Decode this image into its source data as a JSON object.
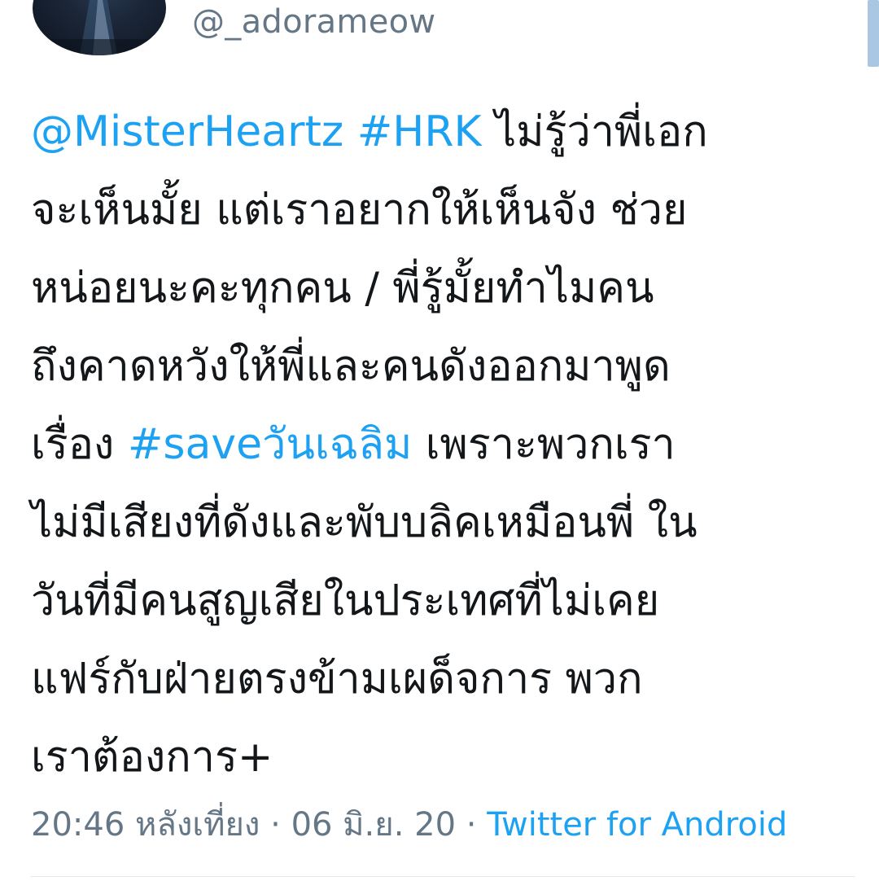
{
  "user": {
    "handle": "@_adorameow"
  },
  "tweet": {
    "lines": [
      [
        {
          "text": "@MisterHeartz",
          "kind": "mention"
        },
        {
          "text": " ",
          "kind": "text"
        },
        {
          "text": "#HRK",
          "kind": "hashtag"
        },
        {
          "text": " ไม่รู้ว่าพี่เอก",
          "kind": "text"
        }
      ],
      [
        {
          "text": "จะเห็นมั้ย แต่เราอยากให้เห็นจัง ช่วย",
          "kind": "text"
        }
      ],
      [
        {
          "text": "หน่อยนะคะทุกคน / พี่รู้มั้ยทำไมคน",
          "kind": "text"
        }
      ],
      [
        {
          "text": "ถึงคาดหวังให้พี่และคนดังออกมาพูด",
          "kind": "text"
        }
      ],
      [
        {
          "text": "เรื่อง ",
          "kind": "text"
        },
        {
          "text": "#saveวันเฉลิม",
          "kind": "hashtag"
        },
        {
          "text": " เพราะพวกเรา",
          "kind": "text"
        }
      ],
      [
        {
          "text": "ไม่มีเสียงที่ดังและพับบลิคเหมือนพี่ ใน",
          "kind": "text"
        }
      ],
      [
        {
          "text": "วันที่มีคนสูญเสียในประเทศที่ไม่เคย",
          "kind": "text"
        }
      ],
      [
        {
          "text": "แฟร์กับฝ่ายตรงข้ามเผด็จการ พวก",
          "kind": "text"
        }
      ],
      [
        {
          "text": "เราต้องการ+",
          "kind": "text"
        }
      ]
    ]
  },
  "meta": {
    "time": "20:46 หลังเที่ยง",
    "separator": " · ",
    "date": "06 มิ.ย. 20",
    "source": "Twitter for Android"
  },
  "colors": {
    "link": "#1da1f2",
    "secondary": "#657786",
    "text": "#14171a"
  }
}
